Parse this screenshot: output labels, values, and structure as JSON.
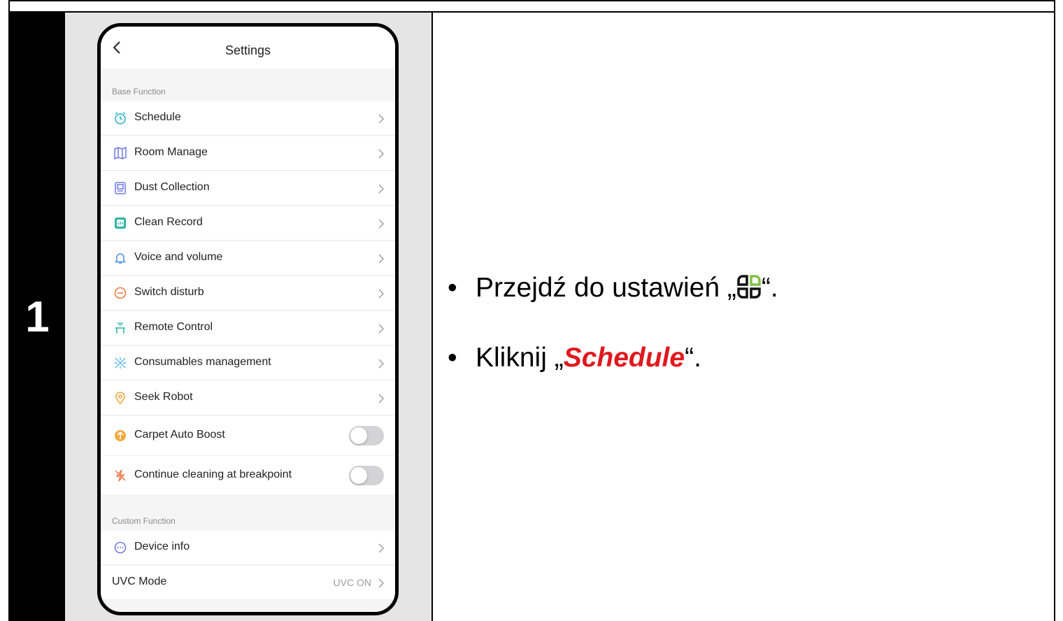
{
  "step": {
    "number": "1"
  },
  "phone": {
    "header": {
      "title": "Settings"
    },
    "sections": [
      {
        "label": "Base Function"
      },
      {
        "label": "Custom Function"
      }
    ],
    "rows": [
      {
        "label": "Schedule",
        "icon": "clock-icon"
      },
      {
        "label": "Room Manage",
        "icon": "map-icon"
      },
      {
        "label": "Dust Collection",
        "icon": "dust-bin-icon"
      },
      {
        "label": "Clean Record",
        "icon": "record-icon"
      },
      {
        "label": "Voice and volume",
        "icon": "bell-icon"
      },
      {
        "label": "Switch disturb",
        "icon": "minus-circle-icon"
      },
      {
        "label": "Remote Control",
        "icon": "remote-icon"
      },
      {
        "label": "Consumables management",
        "icon": "consumables-icon"
      },
      {
        "label": "Seek Robot",
        "icon": "location-pin-icon"
      },
      {
        "label": "Carpet Auto Boost",
        "icon": "boost-icon",
        "toggle": "off"
      },
      {
        "label": "Continue cleaning at breakpoint",
        "icon": "breakpoint-icon",
        "toggle": "off"
      },
      {
        "label": "Device info",
        "icon": "info-dots-icon"
      },
      {
        "label": "UVC Mode",
        "value": "UVC ON"
      }
    ]
  },
  "instructions": {
    "line1_prefix": "Przejdź do ustawień „",
    "line1_suffix": "“.",
    "line2_prefix": "Kliknij „",
    "line2_highlight": "Schedule",
    "line2_suffix": "“."
  },
  "colors": {
    "highlight": "#e0191f",
    "step_bg": "#000000",
    "panel_bg": "#e5e5e5"
  }
}
